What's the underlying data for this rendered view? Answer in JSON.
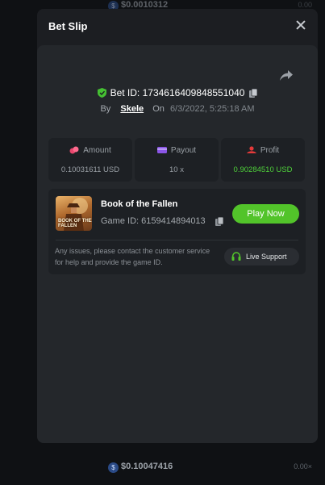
{
  "background": {
    "top_amount": "$0.0010312",
    "top_right": "0.00",
    "bottom_amount": "$0.10047416",
    "bottom_right": "0.00×"
  },
  "modal": {
    "title": "Bet Slip"
  },
  "bet": {
    "id_label": "Bet ID:",
    "id_value": "1734616409848551040",
    "by_label": "By",
    "user": "Skele",
    "on_label": "On",
    "date": "6/3/2022, 5:25:18 AM"
  },
  "stats": {
    "amount_label": "Amount",
    "amount_value": "0.10031611 USD",
    "payout_label": "Payout",
    "payout_value": "10 x",
    "profit_label": "Profit",
    "profit_value": "0.90284510 USD"
  },
  "game": {
    "name": "Book of the Fallen",
    "thumb_text_line1": "BOOK OF THE",
    "thumb_text_line2": "FALLEN",
    "id_label": "Game ID:",
    "id_value": "6159414894013",
    "play_label": "Play Now",
    "support_text": "Any issues, please contact the customer service for help and provide the game ID.",
    "support_label": "Live Support"
  },
  "colors": {
    "accent_green": "#52c42a",
    "profit_green": "#4fd13a",
    "panel": "#24272b"
  },
  "icons": [
    "close-icon",
    "share-icon",
    "shield-check-icon",
    "copy-icon",
    "coins-icon",
    "card-icon",
    "profit-icon",
    "headset-icon",
    "coin-icon"
  ]
}
